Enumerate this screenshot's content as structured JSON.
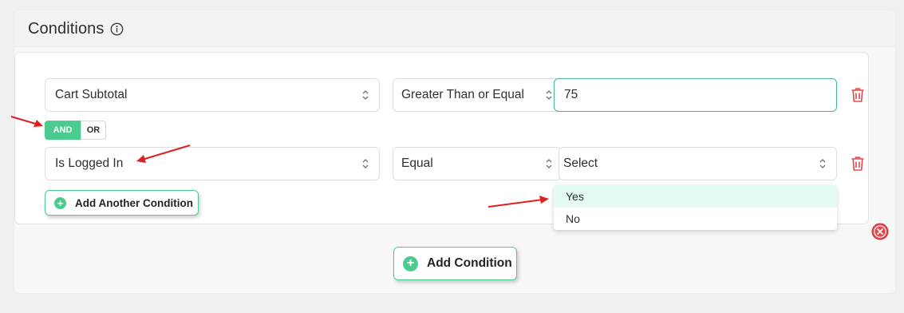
{
  "panel": {
    "title": "Conditions",
    "info_icon": "info-circle-icon"
  },
  "conditions": [
    {
      "field": "Cart Subtotal",
      "operator": "Greater Than or Equal",
      "value": "75"
    },
    {
      "field": "Is Logged In",
      "operator": "Equal",
      "value_select": "Select"
    }
  ],
  "logic": {
    "and_label": "AND",
    "or_label": "OR",
    "selected": "AND"
  },
  "value_dropdown": {
    "options": [
      "Yes",
      "No"
    ],
    "highlighted": "Yes"
  },
  "buttons": {
    "add_another_condition": "Add Another Condition",
    "add_condition": "Add Condition"
  },
  "colors": {
    "accent": "#4ccb8f",
    "delete": "#e5484d",
    "annotation_arrow": "#e02020",
    "option_highlight": "#e3fbf0"
  }
}
